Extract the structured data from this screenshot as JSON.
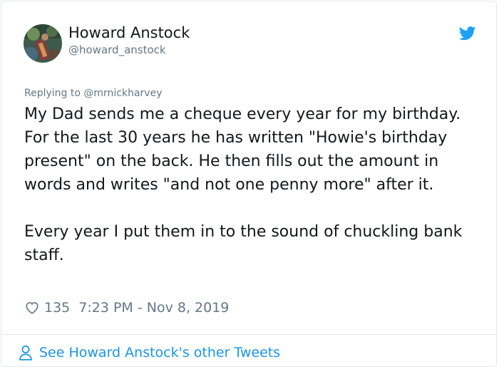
{
  "author": {
    "display_name": "Howard Anstock",
    "handle": "@howard_anstock",
    "avatar_icon": "avatar-photo"
  },
  "brand": {
    "icon": "twitter-bird-icon",
    "color": "#1da1f2"
  },
  "tweet": {
    "reply_to": "Replying to @mrnickharvey",
    "paragraphs": [
      "My Dad sends me a cheque every year for my birthday. For the last 30 years he has written \"Howie's birthday present\" on the back. He then fills out the amount in words and writes \"and not one penny more\" after it.",
      "Every year I put them in to the sound of chuckling bank staff."
    ],
    "like_count": "135",
    "timestamp": "7:23 PM - Nov 8, 2019"
  },
  "footer": {
    "link_text": "See Howard Anstock's other Tweets",
    "icon": "person-icon",
    "link_color": "#1b95e0"
  },
  "colors": {
    "text": "#14171a",
    "secondary": "#657786",
    "border": "#e1e8ed"
  }
}
